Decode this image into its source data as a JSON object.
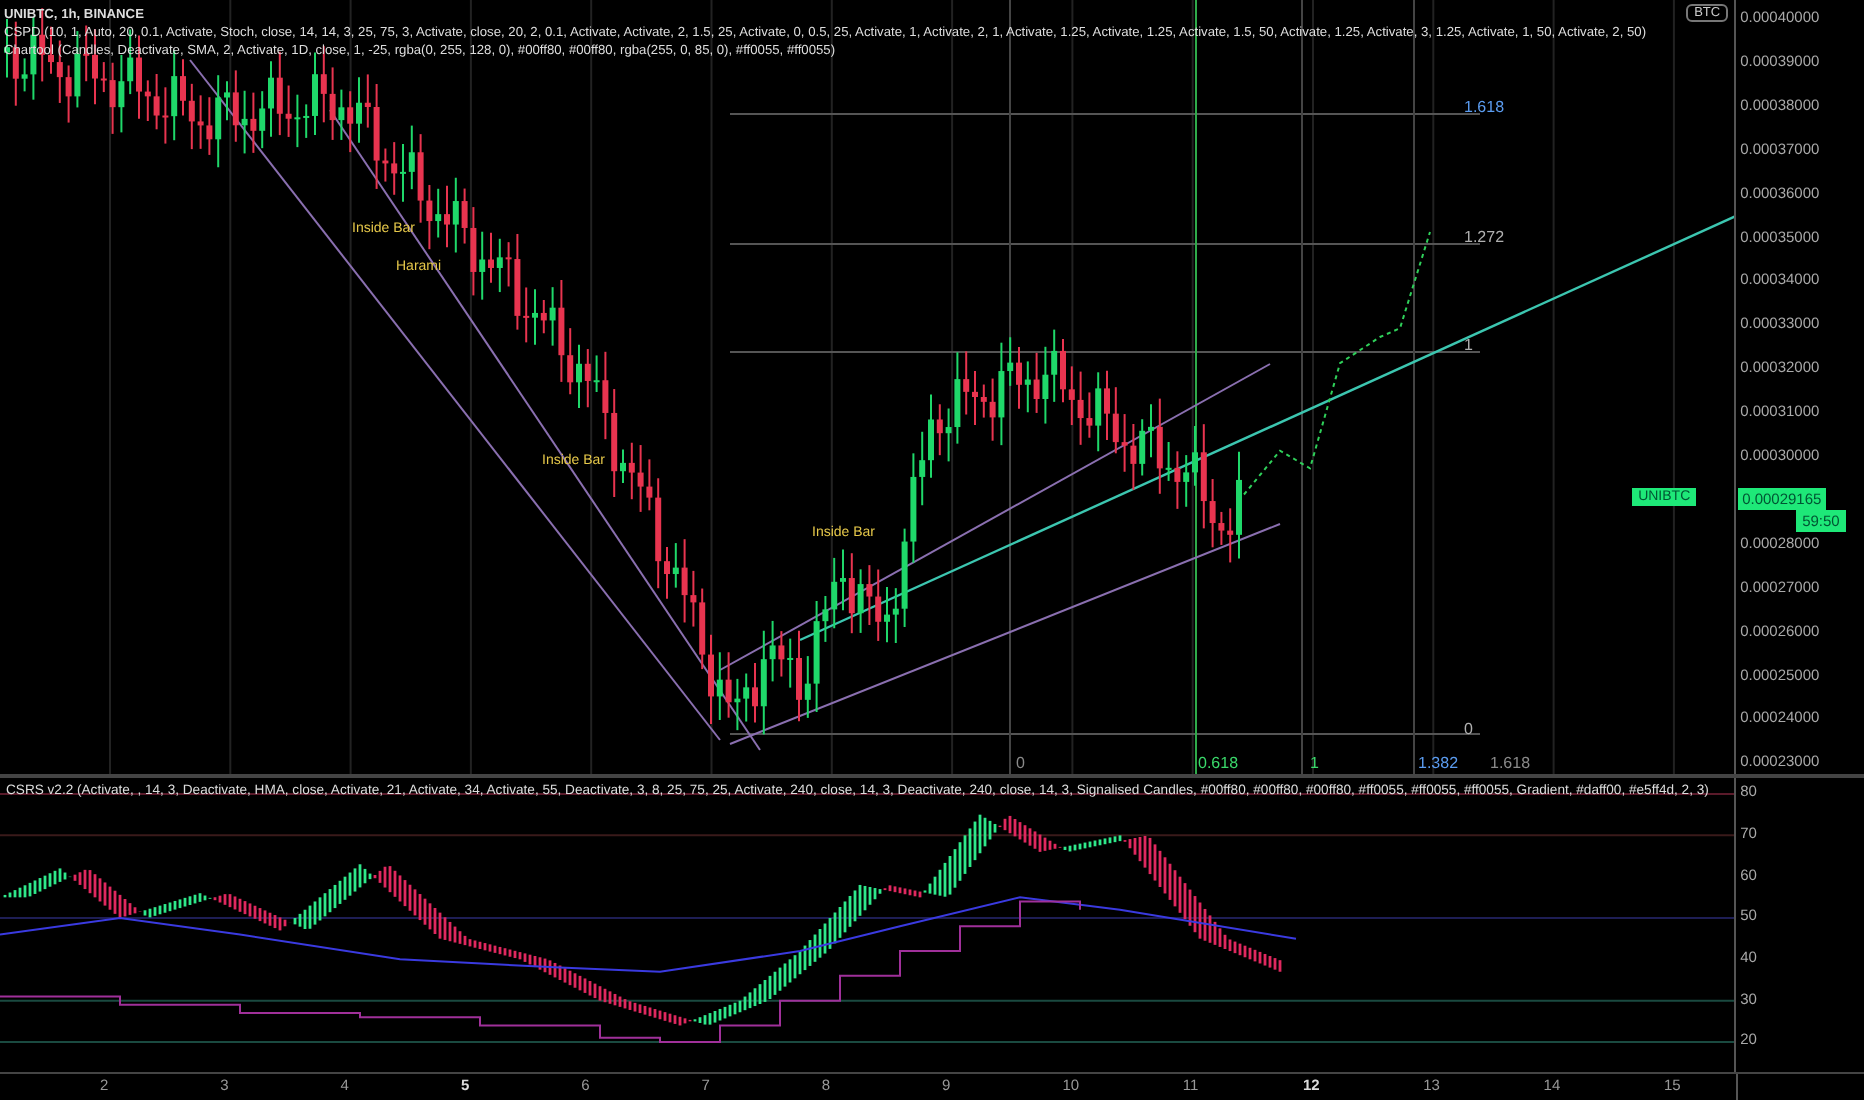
{
  "main_pane": {
    "legend": [
      "UNIBTC, 1h, BINANCE",
      "CSPD (10, 1, Auto, 20, 0.1, Activate, Stoch, close, 14, 14, 3, 25, 75, 3, Activate, close, 20, 2, 0.1, Activate, Activate, 2, 1.5, 25, Activate, 0, 0.5, 25, Activate, 1, Activate, 2, 1, Activate, 1.25, Activate, 1.25, Activate, 1.5, 50, Activate, 1.25, Activate, 3, 1.25, Activate, 1, 50, Activate, 2, 50)",
      "Chartool (Candles, Deactivate, SMA, 2, Activate, 1D, close, 1, -25, rgba(0, 255, 128, 0), #00ff80, #00ff80, rgba(255, 0, 85, 0), #ff0055, #ff0055)"
    ],
    "pattern_labels": [
      {
        "text": "Inside Bar"
      },
      {
        "text": "Harami"
      },
      {
        "text": "Inside Bar"
      },
      {
        "text": "Inside Bar"
      }
    ],
    "fib_levels": [
      {
        "text": "1.618"
      },
      {
        "text": "1.272"
      },
      {
        "text": "1"
      },
      {
        "text": "0"
      }
    ],
    "fib_time_ratios": [
      {
        "text": "0"
      },
      {
        "text": "0.618"
      },
      {
        "text": "1"
      },
      {
        "text": "1.382"
      },
      {
        "text": "1.618"
      }
    ],
    "price_axis": {
      "currency_badge": "BTC",
      "labels": [
        "0.00040000",
        "0.00039000",
        "0.00038000",
        "0.00037000",
        "0.00036000",
        "0.00035000",
        "0.00034000",
        "0.00033000",
        "0.00032000",
        "0.00031000",
        "0.00030000",
        "0.00028000",
        "0.00027000",
        "0.00026000",
        "0.00025000",
        "0.00024000",
        "0.00023000"
      ]
    },
    "price_tag": {
      "symbol": "UNIBTC",
      "price": "0.00029165",
      "countdown": "59:50"
    }
  },
  "indicator_pane": {
    "legend": "CSRS v2.2 (Activate, , 14, 3, Deactivate, HMA, close, Activate, 21, Activate, 34, Activate, 55, Deactivate, 3, 8, 25, 75, 25, Activate, 240, close, 14, 3, Deactivate, 240, close, 14, 3, Signalised Candles, #00ff80, #00ff80, #00ff80, #ff0055, #ff0055, #ff0055, Gradient, #daff00, #e5ff4d, 2, 3)",
    "axis_labels": [
      "80",
      "70",
      "60",
      "50",
      "40",
      "30",
      "20"
    ]
  },
  "time_axis": [
    {
      "text": "2",
      "bold": false
    },
    {
      "text": "3",
      "bold": false
    },
    {
      "text": "4",
      "bold": false
    },
    {
      "text": "5",
      "bold": true
    },
    {
      "text": "6",
      "bold": false
    },
    {
      "text": "7",
      "bold": false
    },
    {
      "text": "8",
      "bold": false
    },
    {
      "text": "9",
      "bold": false
    },
    {
      "text": "10",
      "bold": false
    },
    {
      "text": "11",
      "bold": false
    },
    {
      "text": "12",
      "bold": true
    },
    {
      "text": "13",
      "bold": false
    },
    {
      "text": "14",
      "bold": false
    },
    {
      "text": "15",
      "bold": false
    }
  ]
}
